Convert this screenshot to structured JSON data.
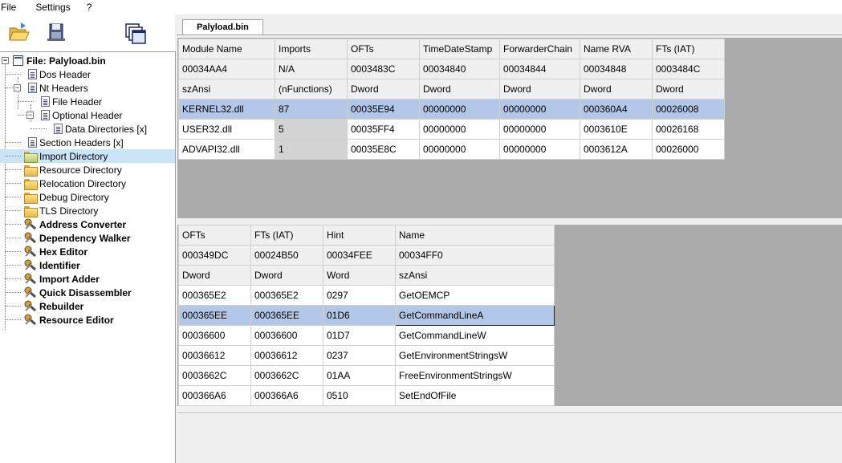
{
  "menu": [
    "File",
    "Settings",
    "?"
  ],
  "tab": {
    "label": "Palyload.bin"
  },
  "tree": {
    "root": "File: Palyload.bin",
    "items": [
      {
        "label": "Dos Header",
        "icon": "doc",
        "bold": false
      },
      {
        "label": "Nt Headers",
        "icon": "doc",
        "bold": false
      },
      {
        "label": "File Header",
        "icon": "doc",
        "bold": false
      },
      {
        "label": "Optional Header",
        "icon": "doc",
        "bold": false
      },
      {
        "label": "Data Directories [x]",
        "icon": "doc",
        "bold": false
      },
      {
        "label": "Section Headers [x]",
        "icon": "doc",
        "bold": false
      },
      {
        "label": "Import Directory",
        "icon": "folder-green",
        "bold": false
      },
      {
        "label": "Resource Directory",
        "icon": "folder",
        "bold": false
      },
      {
        "label": "Relocation Directory",
        "icon": "folder",
        "bold": false
      },
      {
        "label": "Debug Directory",
        "icon": "folder",
        "bold": false
      },
      {
        "label": "TLS Directory",
        "icon": "folder",
        "bold": false
      },
      {
        "label": "Address Converter",
        "icon": "tool",
        "bold": true
      },
      {
        "label": "Dependency Walker",
        "icon": "tool",
        "bold": true
      },
      {
        "label": "Hex Editor",
        "icon": "tool",
        "bold": true
      },
      {
        "label": "Identifier",
        "icon": "tool",
        "bold": true
      },
      {
        "label": "Import Adder",
        "icon": "tool",
        "bold": true
      },
      {
        "label": "Quick Disassembler",
        "icon": "tool",
        "bold": true
      },
      {
        "label": "Rebuilder",
        "icon": "tool",
        "bold": true
      },
      {
        "label": "Resource Editor",
        "icon": "tool",
        "bold": true
      }
    ]
  },
  "modules_table": {
    "header_rows": [
      [
        "Module Name",
        "Imports",
        "OFTs",
        "TimeDateStamp",
        "ForwarderChain",
        "Name RVA",
        "FTs (IAT)"
      ],
      [
        "00034AA4",
        "N/A",
        "0003483C",
        "00034840",
        "00034844",
        "00034848",
        "0003484C"
      ],
      [
        "szAnsi",
        "(nFunctions)",
        "Dword",
        "Dword",
        "Dword",
        "Dword",
        "Dword"
      ]
    ],
    "rows": [
      [
        "KERNEL32.dll",
        "87",
        "00035E94",
        "00000000",
        "00000000",
        "000360A4",
        "00026008"
      ],
      [
        "USER32.dll",
        "5",
        "00035FF4",
        "00000000",
        "00000000",
        "0003610E",
        "00026168"
      ],
      [
        "ADVAPI32.dll",
        "1",
        "00035E8C",
        "00000000",
        "00000000",
        "0003612A",
        "00026000"
      ]
    ]
  },
  "functions_table": {
    "header_rows": [
      [
        "OFTs",
        "FTs (IAT)",
        "Hint",
        "Name"
      ],
      [
        "000349DC",
        "00024B50",
        "00034FEE",
        "00034FF0"
      ],
      [
        "Dword",
        "Dword",
        "Word",
        "szAnsi"
      ]
    ],
    "rows": [
      [
        "000365E2",
        "000365E2",
        "0297",
        "GetOEMCP"
      ],
      [
        "000365EE",
        "000365EE",
        "01D6",
        "GetCommandLineA"
      ],
      [
        "00036600",
        "00036600",
        "01D7",
        "GetCommandLineW"
      ],
      [
        "00036612",
        "00036612",
        "0237",
        "GetEnvironmentStringsW"
      ],
      [
        "0003662C",
        "0003662C",
        "01AA",
        "FreeEnvironmentStringsW"
      ],
      [
        "000366A6",
        "000366A6",
        "0510",
        "SetEndOfFile"
      ]
    ]
  }
}
